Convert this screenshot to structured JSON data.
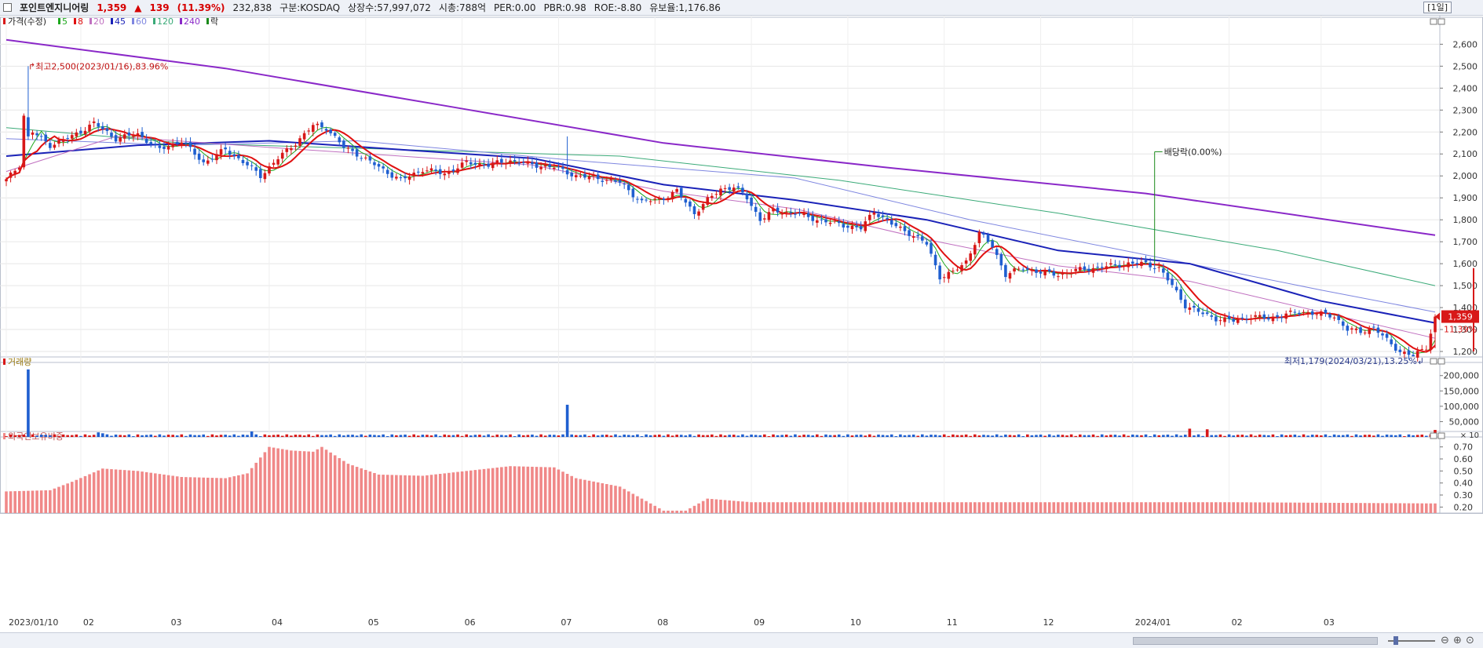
{
  "header": {
    "stock_name": "포인트엔지니어링",
    "price": "1,359",
    "change_arrow": "▲",
    "change": "139",
    "change_pct": "(11.39%)",
    "volume": "232,838",
    "market": "구분:KOSDAQ",
    "shares": "상장수:57,997,072",
    "market_cap": "시총:788억",
    "per": "PER:0.00",
    "pbr": "PBR:0.98",
    "roe": "ROE:-8.80",
    "float_ratio": "유보율:1,176.86",
    "period": "[1일]"
  },
  "legend": {
    "price_label": "가격(수정)",
    "ma": [
      {
        "label": "5",
        "color": "#1ea81e"
      },
      {
        "label": "8",
        "color": "#e01010"
      },
      {
        "label": "20",
        "color": "#c070c0"
      },
      {
        "label": "45",
        "color": "#1a22b8"
      },
      {
        "label": "60",
        "color": "#7e86e0"
      },
      {
        "label": "120",
        "color": "#3aaa78"
      },
      {
        "label": "240",
        "color": "#8a28c8"
      }
    ],
    "event_label": "락"
  },
  "annotations": {
    "high": "최고2,500(2023/01/16),83.96%",
    "low": "최저1,179(2024/03/21),13.25%",
    "dividend": "배당락(0.00%)",
    "current_price": "1,359",
    "current_pct": "11.39%"
  },
  "colors": {
    "up": "#d81818",
    "down": "#1f5fd0",
    "foreign_bar": "#f08888",
    "background": "#ffffff",
    "grid": "#e6e6e6"
  },
  "panes": {
    "volume_label": "거래량",
    "foreign_label": "외국인보유비중",
    "volume_unit": "× 10"
  },
  "chart_data": [
    {
      "type": "candlestick",
      "title": "",
      "x_range": [
        "2023/01/10",
        "2024/03/29"
      ],
      "ylim": [
        1150,
        2680
      ],
      "y_ticks": [
        1200,
        1300,
        1400,
        1500,
        1600,
        1700,
        1800,
        1900,
        2000,
        2100,
        2200,
        2300,
        2400,
        2500,
        2600
      ],
      "y_tick_labels": [
        "1,200",
        "1,300",
        "1,400",
        "1,500",
        "1,600",
        "1,700",
        "1,800",
        "1,900",
        "2,000",
        "2,100",
        "2,200",
        "2,300",
        "2,400",
        "2,500",
        "2,600"
      ],
      "x_tick_labels": [
        "2023/01/10",
        "02",
        "03",
        "04",
        "05",
        "06",
        "07",
        "08",
        "09",
        "10",
        "11",
        "12",
        "2024/01",
        "02",
        "03"
      ],
      "close_path": [
        [
          0,
          1980
        ],
        [
          3,
          2050
        ],
        [
          5,
          2500
        ],
        [
          6,
          2200
        ],
        [
          10,
          2140
        ],
        [
          15,
          2180
        ],
        [
          20,
          2240
        ],
        [
          25,
          2170
        ],
        [
          30,
          2190
        ],
        [
          35,
          2120
        ],
        [
          40,
          2160
        ],
        [
          45,
          2060
        ],
        [
          50,
          2120
        ],
        [
          55,
          2050
        ],
        [
          58,
          2000
        ],
        [
          62,
          2080
        ],
        [
          66,
          2150
        ],
        [
          70,
          2230
        ],
        [
          73,
          2220
        ],
        [
          77,
          2130
        ],
        [
          80,
          2100
        ],
        [
          85,
          2040
        ],
        [
          90,
          1980
        ],
        [
          95,
          2030
        ],
        [
          100,
          2010
        ],
        [
          105,
          2060
        ],
        [
          110,
          2050
        ],
        [
          115,
          2070
        ],
        [
          120,
          2050
        ],
        [
          125,
          2040
        ],
        [
          130,
          2000
        ],
        [
          135,
          1990
        ],
        [
          140,
          1970
        ],
        [
          145,
          1880
        ],
        [
          150,
          1900
        ],
        [
          153,
          1930
        ],
        [
          157,
          1830
        ],
        [
          160,
          1890
        ],
        [
          163,
          1940
        ],
        [
          166,
          1950
        ],
        [
          169,
          1900
        ],
        [
          172,
          1800
        ],
        [
          175,
          1840
        ],
        [
          180,
          1830
        ],
        [
          185,
          1800
        ],
        [
          190,
          1780
        ],
        [
          195,
          1760
        ],
        [
          198,
          1840
        ],
        [
          202,
          1780
        ],
        [
          206,
          1740
        ],
        [
          210,
          1690
        ],
        [
          213,
          1540
        ],
        [
          216,
          1560
        ],
        [
          219,
          1610
        ],
        [
          222,
          1740
        ],
        [
          225,
          1680
        ],
        [
          228,
          1550
        ],
        [
          232,
          1580
        ],
        [
          236,
          1560
        ],
        [
          240,
          1550
        ],
        [
          244,
          1570
        ],
        [
          248,
          1580
        ],
        [
          252,
          1590
        ],
        [
          256,
          1600
        ],
        [
          260,
          1600
        ],
        [
          263,
          1580
        ],
        [
          266,
          1500
        ],
        [
          269,
          1410
        ],
        [
          272,
          1380
        ],
        [
          276,
          1350
        ],
        [
          280,
          1340
        ],
        [
          284,
          1360
        ],
        [
          288,
          1350
        ],
        [
          292,
          1370
        ],
        [
          296,
          1380
        ],
        [
          300,
          1370
        ],
        [
          303,
          1360
        ],
        [
          306,
          1300
        ],
        [
          309,
          1290
        ],
        [
          312,
          1310
        ],
        [
          315,
          1250
        ],
        [
          318,
          1200
        ],
        [
          321,
          1179
        ],
        [
          324,
          1220
        ],
        [
          326,
          1359
        ]
      ],
      "ma_paths": [
        {
          "name": "240",
          "points": [
            [
              0,
              2620
            ],
            [
              50,
              2490
            ],
            [
              100,
              2320
            ],
            [
              150,
              2150
            ],
            [
              200,
              2040
            ],
            [
              260,
              1920
            ],
            [
              326,
              1730
            ]
          ]
        },
        {
          "name": "120",
          "points": [
            [
              0,
              2220
            ],
            [
              40,
              2150
            ],
            [
              90,
              2120
            ],
            [
              140,
              2090
            ],
            [
              190,
              1980
            ],
            [
              240,
              1830
            ],
            [
              290,
              1660
            ],
            [
              326,
              1500
            ]
          ]
        },
        {
          "name": "60",
          "points": [
            [
              0,
              2170
            ],
            [
              40,
              2140
            ],
            [
              80,
              2160
            ],
            [
              130,
              2070
            ],
            [
              180,
              1990
            ],
            [
              220,
              1800
            ],
            [
              260,
              1640
            ],
            [
              300,
              1480
            ],
            [
              326,
              1380
            ]
          ]
        },
        {
          "name": "45",
          "points": [
            [
              0,
              2090
            ],
            [
              30,
              2140
            ],
            [
              60,
              2160
            ],
            [
              90,
              2120
            ],
            [
              120,
              2080
            ],
            [
              150,
              1960
            ],
            [
              180,
              1890
            ],
            [
              210,
              1800
            ],
            [
              240,
              1660
            ],
            [
              270,
              1600
            ],
            [
              300,
              1430
            ],
            [
              326,
              1330
            ]
          ]
        },
        {
          "name": "20",
          "points": [
            [
              0,
              2020
            ],
            [
              25,
              2180
            ],
            [
              60,
              2130
            ],
            [
              90,
              2090
            ],
            [
              120,
              2050
            ],
            [
              150,
              1930
            ],
            [
              180,
              1850
            ],
            [
              210,
              1710
            ],
            [
              240,
              1590
            ],
            [
              270,
              1520
            ],
            [
              300,
              1380
            ],
            [
              326,
              1260
            ]
          ]
        }
      ]
    },
    {
      "type": "bar",
      "title": "",
      "ylim": [
        0,
        230000
      ],
      "y_ticks": [
        50000,
        100000,
        150000,
        200000
      ],
      "y_tick_labels": [
        "50,000",
        "100,000",
        "150,000",
        "200,000"
      ],
      "spikes": [
        [
          5,
          220000
        ],
        [
          21,
          15000
        ],
        [
          22,
          12000
        ],
        [
          56,
          18000
        ],
        [
          128,
          105000
        ],
        [
          270,
          27000
        ],
        [
          274,
          25000
        ],
        [
          326,
          23000
        ],
        [
          224,
          6000
        ]
      ],
      "base_volume": 5000
    },
    {
      "type": "bar",
      "title": "",
      "ylim": [
        0.15,
        0.75
      ],
      "y_ticks": [
        0.2,
        0.3,
        0.4,
        0.5,
        0.6,
        0.7
      ],
      "y_tick_labels": [
        "0.20",
        "0.30",
        "0.40",
        "0.50",
        "0.60",
        "0.70"
      ],
      "series_path": [
        [
          0,
          0.33
        ],
        [
          10,
          0.34
        ],
        [
          15,
          0.41
        ],
        [
          22,
          0.52
        ],
        [
          30,
          0.5
        ],
        [
          40,
          0.45
        ],
        [
          50,
          0.44
        ],
        [
          55,
          0.48
        ],
        [
          60,
          0.7
        ],
        [
          65,
          0.67
        ],
        [
          70,
          0.66
        ],
        [
          72,
          0.7
        ],
        [
          78,
          0.56
        ],
        [
          85,
          0.47
        ],
        [
          95,
          0.46
        ],
        [
          105,
          0.5
        ],
        [
          115,
          0.54
        ],
        [
          125,
          0.53
        ],
        [
          130,
          0.44
        ],
        [
          140,
          0.37
        ],
        [
          145,
          0.27
        ],
        [
          150,
          0.17
        ],
        [
          155,
          0.17
        ],
        [
          160,
          0.27
        ],
        [
          170,
          0.24
        ],
        [
          180,
          0.24
        ],
        [
          230,
          0.24
        ],
        [
          280,
          0.24
        ],
        [
          326,
          0.23
        ]
      ]
    }
  ]
}
